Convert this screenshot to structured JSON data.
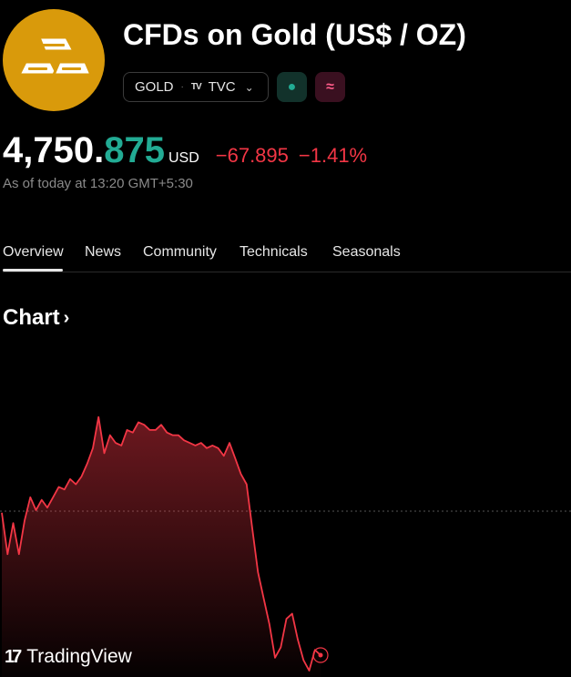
{
  "header": {
    "title": "CFDs on Gold (US$ / OZ)",
    "logo_icon": "gold-bars-icon",
    "logo_color": "#d99a0b"
  },
  "badges": {
    "symbol": "GOLD",
    "separator": "·",
    "exchange_logo": "TV",
    "exchange": "TVC",
    "dropdown_icon": "chevron-down-icon",
    "market_status_icon": "market-open-dot-icon",
    "market_status_symbol": "●",
    "delay_icon": "delayed-data-icon",
    "delay_symbol": "≈"
  },
  "quote": {
    "price_main": "4,750.",
    "price_decimals": "875",
    "currency": "USD",
    "change": "−67.895",
    "change_percent": "−1.41%",
    "as_of": "As of today at 13:20 GMT+5:30",
    "positive_color": "#22ab94",
    "negative_color": "#f23645"
  },
  "tabs": [
    {
      "label": "Overview",
      "active": true
    },
    {
      "label": "News",
      "active": false
    },
    {
      "label": "Community",
      "active": false
    },
    {
      "label": "Technicals",
      "active": false
    },
    {
      "label": "Seasonals",
      "active": false
    }
  ],
  "chart_section": {
    "heading": "Chart",
    "chevron": "›"
  },
  "chart_data": {
    "type": "area",
    "title": "",
    "xlabel": "",
    "ylabel": "",
    "grid": false,
    "line_color": "#f23645",
    "reference_line": "previous close (dotted)",
    "y": [
      0.61,
      0.45,
      0.57,
      0.45,
      0.58,
      0.67,
      0.62,
      0.66,
      0.63,
      0.67,
      0.71,
      0.7,
      0.74,
      0.72,
      0.75,
      0.8,
      0.86,
      0.98,
      0.84,
      0.91,
      0.88,
      0.87,
      0.93,
      0.92,
      0.96,
      0.95,
      0.93,
      0.93,
      0.95,
      0.92,
      0.91,
      0.91,
      0.89,
      0.88,
      0.87,
      0.88,
      0.86,
      0.87,
      0.86,
      0.83,
      0.88,
      0.82,
      0.76,
      0.72,
      0.55,
      0.38,
      0.28,
      0.18,
      0.05,
      0.09,
      0.2,
      0.22,
      0.12,
      0.04,
      0.0,
      0.08,
      0.06
    ],
    "end_marker": true
  },
  "branding": {
    "mark": "17",
    "name": "TradingView"
  }
}
